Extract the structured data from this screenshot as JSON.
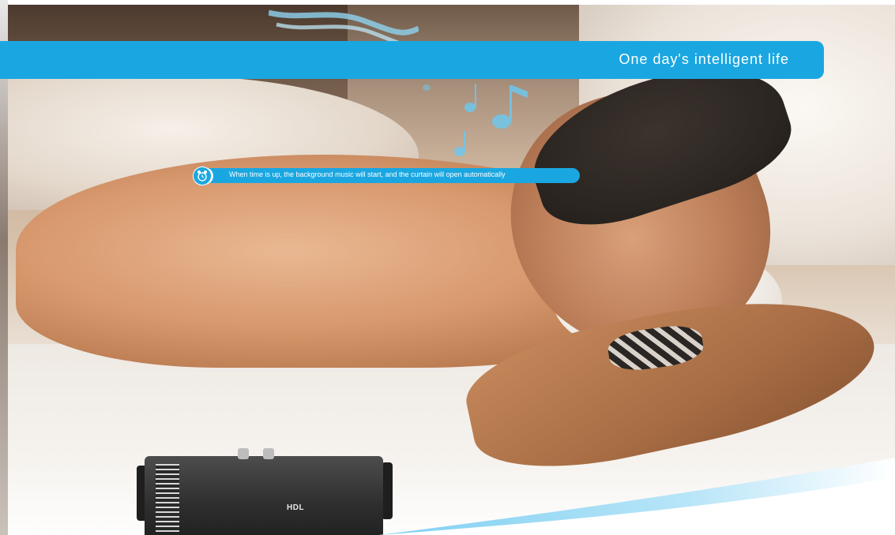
{
  "banner": {
    "title": "One day's intelligent life",
    "color": "#1aa7e1"
  },
  "notice": {
    "icon": "alarm-clock-icon",
    "text": "When time is up, the background music will start, and the curtain will open automatically"
  },
  "device": {
    "brand_label": "HDL"
  },
  "decorations": {
    "music_icon": "music-notes-icon",
    "accent_color": "#1aa7e1"
  }
}
